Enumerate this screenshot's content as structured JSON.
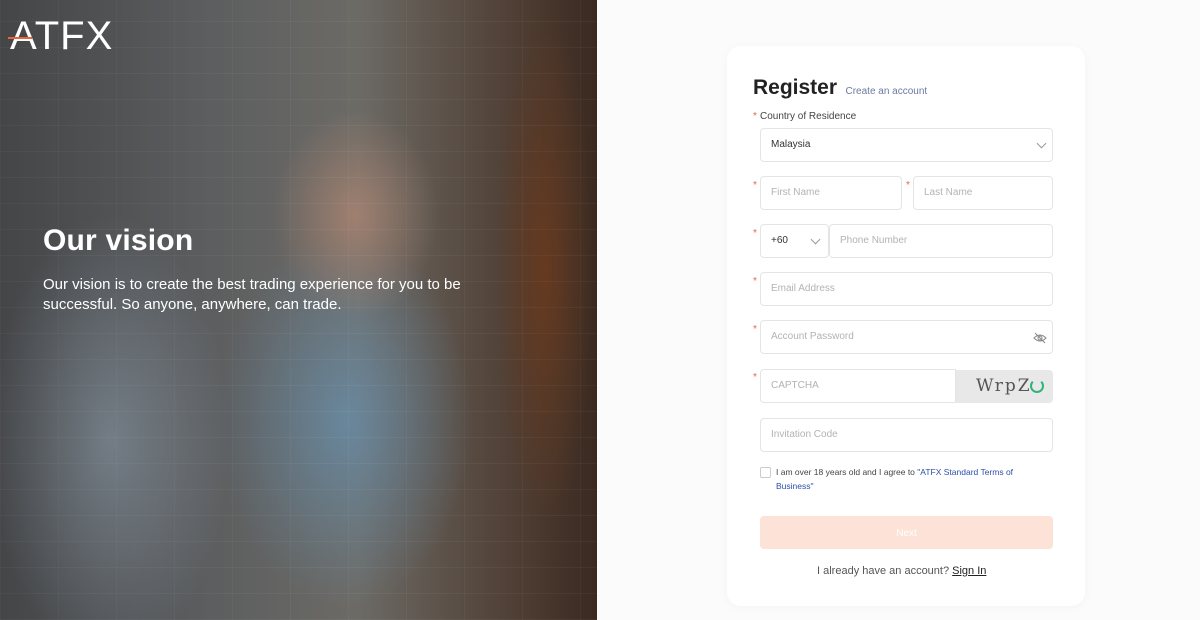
{
  "brand": {
    "logo_text": "ATFX",
    "accent": "#e8643a"
  },
  "hero": {
    "title": "Our vision",
    "text": "Our vision is to create the best trading experience for you to be successful. So anyone, anywhere, can trade."
  },
  "register": {
    "title": "Register",
    "subtitle": "Create an account",
    "country_label": "Country of Residence",
    "country_value": "Malaysia",
    "first_name_placeholder": "First Name",
    "last_name_placeholder": "Last Name",
    "dial_code": "+60",
    "phone_placeholder": "Phone Number",
    "email_placeholder": "Email Address",
    "password_placeholder": "Account Password",
    "captcha_placeholder": "CAPTCHA",
    "captcha_code": "WrpZ",
    "invitation_placeholder": "Invitation Code",
    "terms_text": "I am over 18 years old and I agree to ",
    "terms_link": "\"ATFX Standard Terms of Business\"",
    "submit_label": "Next",
    "signin_prompt": "I already have an account?",
    "signin_link": "Sign In"
  },
  "colors": {
    "button_bg": "#fde2d7",
    "link": "#2d4fa8",
    "required_star": "#e8643a"
  }
}
